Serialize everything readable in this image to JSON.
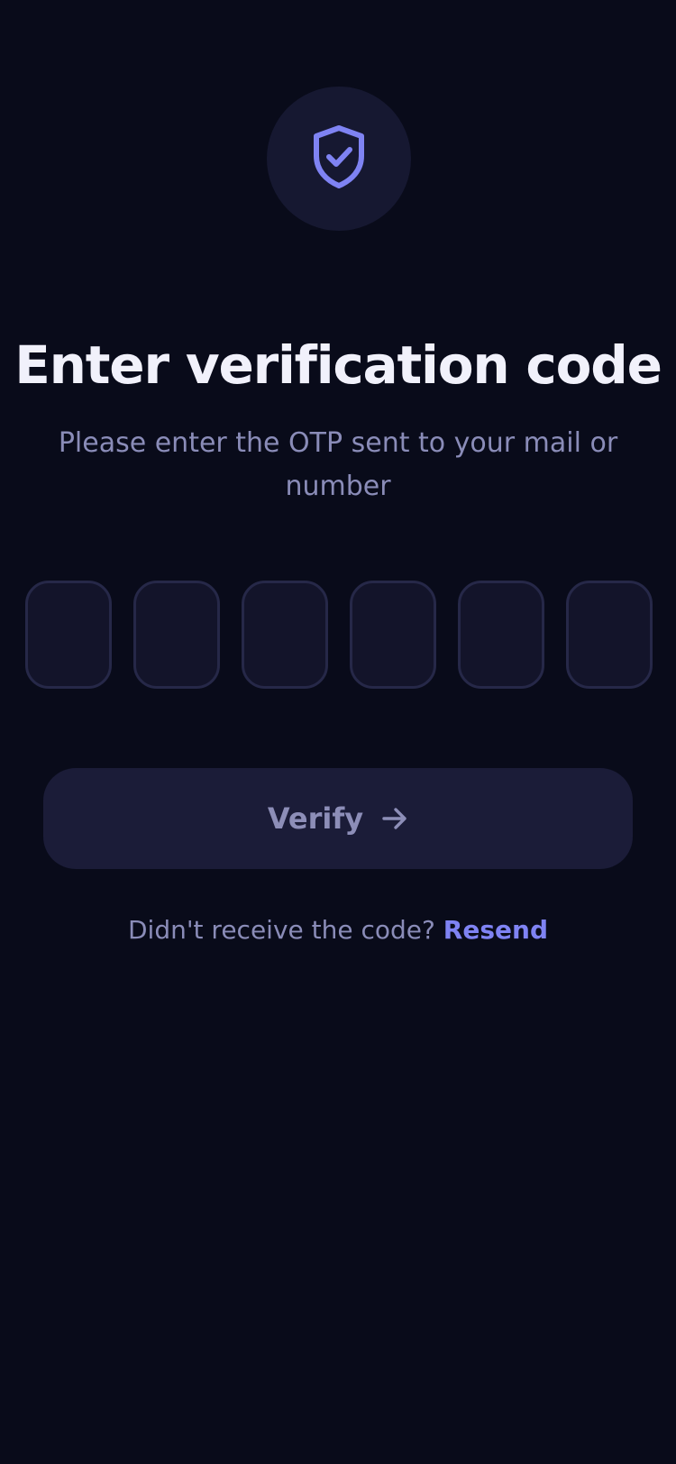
{
  "header": {
    "icon": "shield-check-icon",
    "title": "Enter verification code",
    "subtitle": "Please enter the OTP sent to your mail or number"
  },
  "otp": {
    "digits": [
      "",
      "",
      "",
      "",
      "",
      ""
    ]
  },
  "actions": {
    "verify_label": "Verify",
    "verify_icon": "arrow-right-icon"
  },
  "resend": {
    "prompt": "Didn't receive the code?",
    "link_label": "Resend"
  },
  "colors": {
    "background": "#090b1a",
    "accent": "#7f83f3",
    "title_text": "#f1f1fb",
    "muted_text": "#8a8cb8",
    "input_border": "#262848",
    "button_bg": "#1b1c38"
  }
}
